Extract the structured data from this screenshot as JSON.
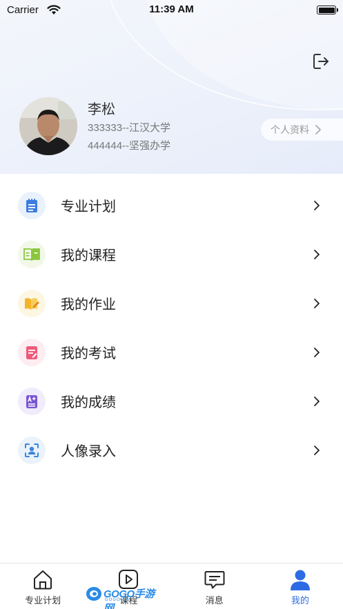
{
  "status_bar": {
    "carrier": "Carrier",
    "time": "11:39 AM"
  },
  "profile": {
    "name": "李松",
    "line1": "333333--江汉大学",
    "line2": "444444--坚强办学",
    "profile_link": "个人资料"
  },
  "menu": {
    "items": [
      {
        "label": "专业计划",
        "icon": "notepad-icon",
        "color": "#3b7de0",
        "bg": "#e9f1fd"
      },
      {
        "label": "我的课程",
        "icon": "book-icon",
        "color": "#8bc63f",
        "bg": "#f2f8e8"
      },
      {
        "label": "我的作业",
        "icon": "book-pencil-icon",
        "color": "#f2b52a",
        "bg": "#fdf6e3"
      },
      {
        "label": "我的考试",
        "icon": "exam-icon",
        "color": "#ef5a7a",
        "bg": "#fdecf0"
      },
      {
        "label": "我的成绩",
        "icon": "score-icon",
        "color": "#7a55d4",
        "bg": "#f1ecfb"
      },
      {
        "label": "人像录入",
        "icon": "face-scan-icon",
        "color": "#3a86d8",
        "bg": "#eaf2fb"
      }
    ]
  },
  "tab_bar": {
    "tabs": [
      {
        "label": "专业计划",
        "icon": "home-icon",
        "active": false
      },
      {
        "label": "课程",
        "icon": "play-icon",
        "active": false
      },
      {
        "label": "消息",
        "icon": "message-icon",
        "active": false
      },
      {
        "label": "我的",
        "icon": "person-icon",
        "active": true
      }
    ],
    "active_color": "#2d6be4"
  },
  "watermark": {
    "text": "GOGO手游网",
    "sub": "GOGO.CN"
  }
}
